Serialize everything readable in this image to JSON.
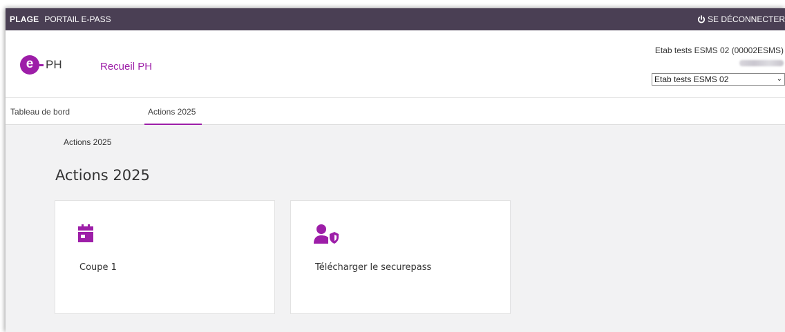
{
  "topbar": {
    "brand": "PLAGE",
    "portal": "PORTAIL E-PASS",
    "logout_label": "SE DÉCONNECTER"
  },
  "header": {
    "logo_letter": "e",
    "logo_text": "PH",
    "app_title": "Recueil PH",
    "establishment_name": "Etab tests ESMS 02 (00002ESMS)",
    "establishment_select": {
      "selected": "Etab tests ESMS 02"
    }
  },
  "tabs": [
    {
      "label": "Tableau de bord",
      "active": false
    },
    {
      "label": "Actions 2025",
      "active": true
    }
  ],
  "breadcrumb": "Actions 2025",
  "page_title": "Actions 2025",
  "cards": [
    {
      "label": "Coupe 1",
      "icon": "calendar-icon"
    },
    {
      "label": "Télécharger le securepass",
      "icon": "user-shield-icon"
    }
  ],
  "colors": {
    "topbar": "#4a3f54",
    "accent": "#9d1ea8",
    "background": "#f2f2f3"
  }
}
